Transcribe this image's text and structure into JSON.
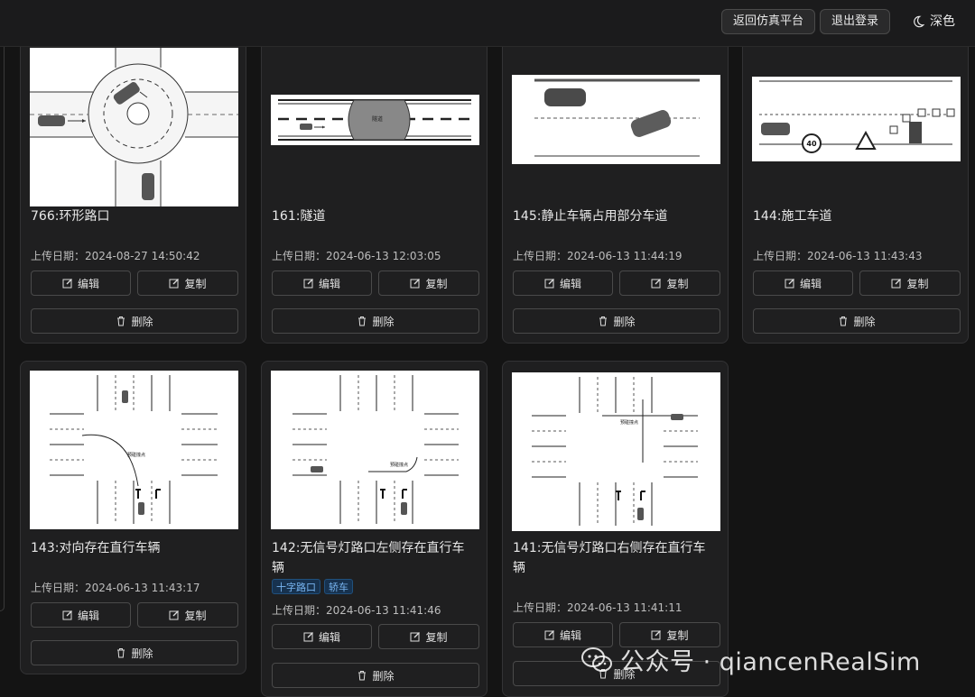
{
  "header": {
    "back_label": "返回仿真平台",
    "logout_label": "退出登录",
    "theme_label": "深色"
  },
  "labels": {
    "date_prefix": "上传日期：",
    "edit": "编辑",
    "copy": "复制",
    "delete": "删除"
  },
  "cards": [
    {
      "title": "766:环形路口",
      "date": "2024-08-27 14:50:42",
      "tags": []
    },
    {
      "title": "161:隧道",
      "date": "2024-06-13 12:03:05",
      "tags": []
    },
    {
      "title": "145:静止车辆占用部分车道",
      "date": "2024-06-13 11:44:19",
      "tags": []
    },
    {
      "title": "144:施工车道",
      "date": "2024-06-13 11:43:43",
      "tags": []
    },
    {
      "title": "143:对向存在直行车辆",
      "date": "2024-06-13 11:43:17",
      "tags": []
    },
    {
      "title": "142:无信号灯路口左侧存在直行车辆",
      "date": "2024-06-13 11:41:46",
      "tags": [
        "十字路口",
        "轿车"
      ]
    },
    {
      "title": "141:无信号灯路口右侧存在直行车辆",
      "date": "2024-06-13 11:41:11",
      "tags": []
    }
  ],
  "thumb_text": {
    "tunnel": "隧道",
    "speed_sign": "40",
    "conflict_point": "预碰撞点"
  },
  "watermark": {
    "text": "公众号 · qiancenRealSim"
  }
}
